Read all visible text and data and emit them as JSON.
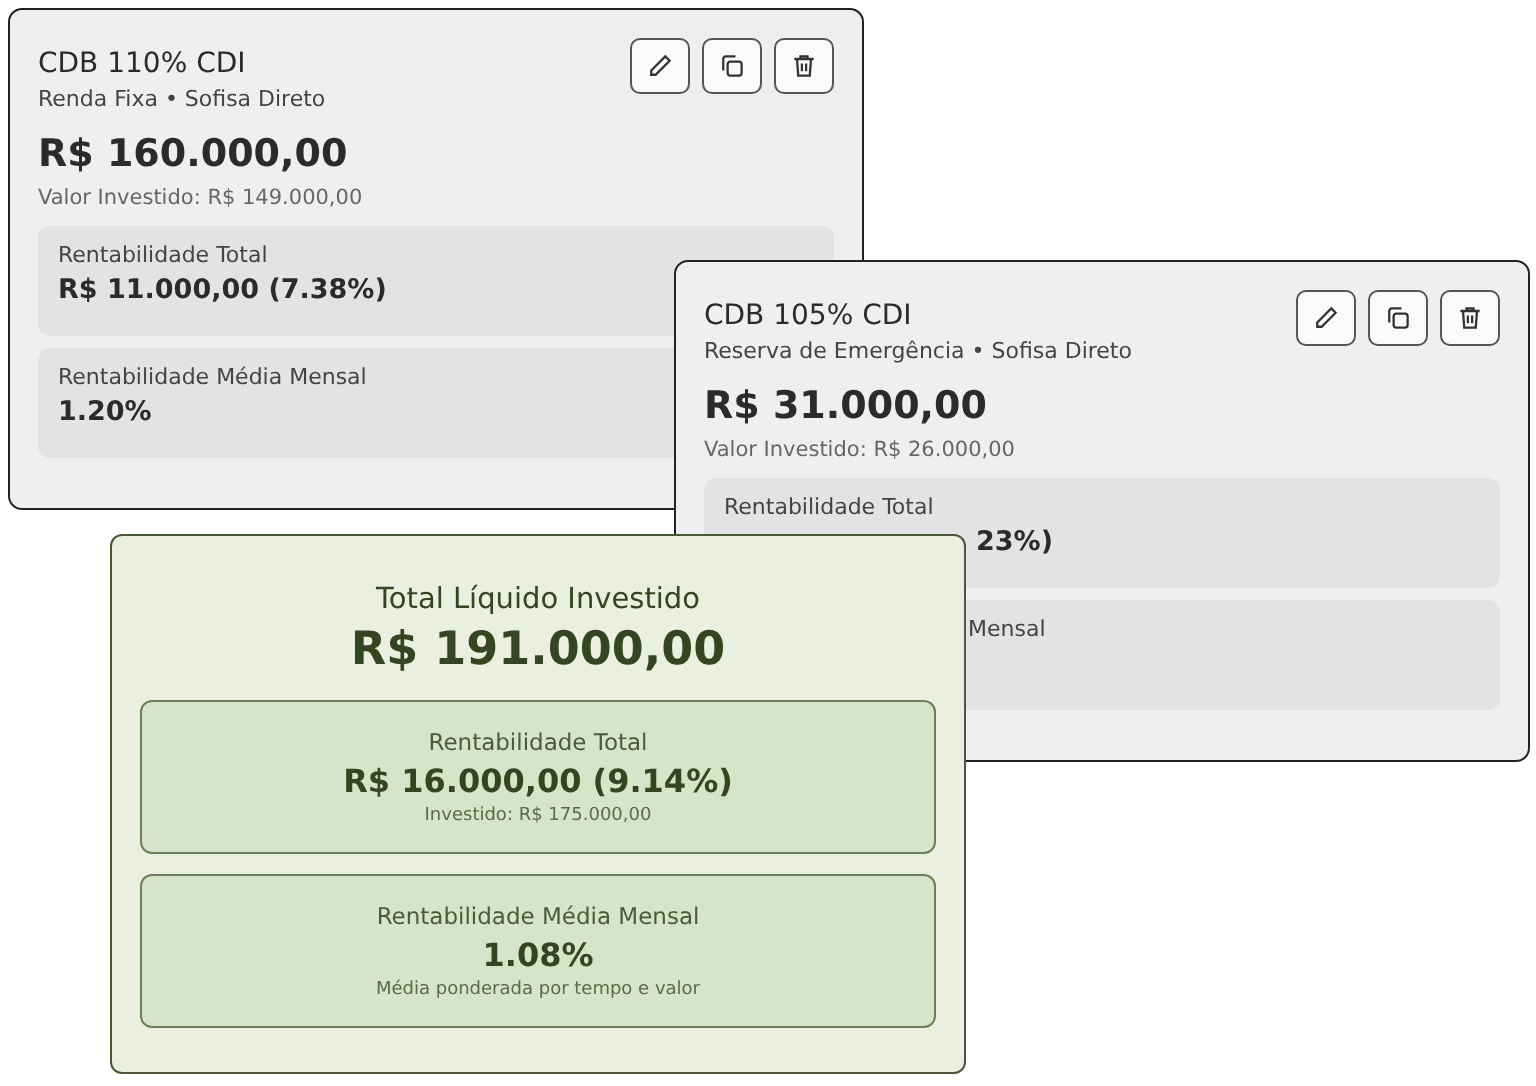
{
  "investments": [
    {
      "title": "CDB 110% CDI",
      "subtitle": "Renda Fixa • Sofisa Direto",
      "amount": "R$ 160.000,00",
      "invested": "Valor Investido: R$ 149.000,00",
      "stats": [
        {
          "label": "Rentabilidade Total",
          "value": "R$ 11.000,00 (7.38%)"
        },
        {
          "label": "Rentabilidade Média Mensal",
          "value": "1.20%"
        }
      ]
    },
    {
      "title": "CDB 105% CDI",
      "subtitle": "Reserva de Emergência • Sofisa Direto",
      "amount": "R$ 31.000,00",
      "invested": "Valor Investido: R$ 26.000,00",
      "stats": [
        {
          "label": "Rentabilidade Total",
          "value": "23%)"
        },
        {
          "label": "Mensal"
        }
      ]
    }
  ],
  "summary": {
    "title": "Total Líquido Investido",
    "amount": "R$ 191.000,00",
    "stats": [
      {
        "label": "Rentabilidade Total",
        "value": "R$ 16.000,00 (9.14%)",
        "note": "Investido: R$ 175.000,00"
      },
      {
        "label": "Rentabilidade Média Mensal",
        "value": "1.08%",
        "note": "Média ponderada por tempo e valor"
      }
    ]
  }
}
